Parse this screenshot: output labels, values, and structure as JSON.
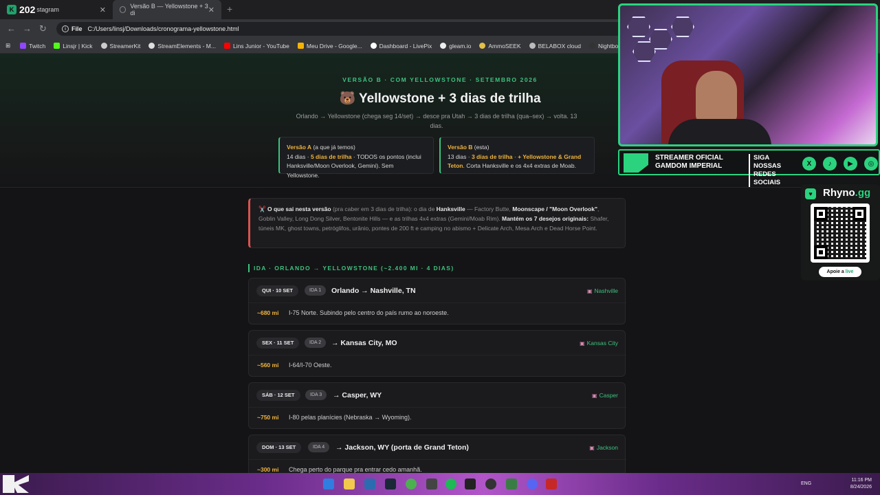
{
  "browser": {
    "tabs": [
      {
        "prefix": "202",
        "label": "stagram"
      },
      {
        "label": "Versão B — Yellowstone + 3 di"
      }
    ],
    "new_tab": "+",
    "url_scheme": "File",
    "url": "C:/Users/linsj/Downloads/cronograma-yellowstone.html",
    "bookmarks": [
      {
        "label": "Twitch",
        "color": "#9146ff"
      },
      {
        "label": "Linsjr | Kick",
        "color": "#53fc18"
      },
      {
        "label": "StreamerKit",
        "color": "#cccccc"
      },
      {
        "label": "StreamElements - M...",
        "color": "#dddddd"
      },
      {
        "label": "Lins Junior - YouTube",
        "color": "#ff0000"
      },
      {
        "label": "Meu Drive - Google...",
        "color": "#f4b400"
      },
      {
        "label": "Dashboard - LivePix",
        "color": "#ffffff"
      },
      {
        "label": "gleam.io",
        "color": "#eeeeee"
      },
      {
        "label": "AmmoSEEK",
        "color": "#e0c04a"
      },
      {
        "label": "BELABOX cloud",
        "color": "#bbbbbb"
      },
      {
        "label": "Nightbot - Comm",
        "color": "#333333"
      }
    ]
  },
  "hero": {
    "kicker": "VERSÃO B · COM YELLOWSTONE · SETEMBRO 2026",
    "title": "🐻 Yellowstone + 3 dias de trilha",
    "subtitle": "Orlando → Yellowstone (chega seg 14/set) → desce pra Utah → 3 dias de trilha (qua–sex) → volta. 13 dias."
  },
  "versions": {
    "a": {
      "name": "Versão A",
      "paren": " (a que já temos)",
      "line_pre": "14 dias · ",
      "highlight": "5 dias de trilha",
      "line_post": " · TODOS os pontos (inclui Hanksville/Moon Overlook, Gemini). Sem Yellowstone."
    },
    "b": {
      "name": "Versão B",
      "paren": " (esta)",
      "line_pre": "13 dias · ",
      "highlight": "3 dias de trilha",
      "mid": " · ",
      "highlight2": "+ Yellowstone & Grand Teton",
      "line_post": ". Corta Hanksville e os 4x4 extras de Moab."
    }
  },
  "notice": {
    "icon": "✂️",
    "b1": "O que sai nesta versão",
    "t1": " (pra caber em 3 dias de trilha): o dia de ",
    "b2": "Hanksville",
    "t2": " — Factory Butte, ",
    "b3": "Moonscape / \"Moon Overlook\"",
    "t3": ", Goblin Valley, Long Dong Silver, Bentonite Hills — e as trilhas 4x4 extras (Gemini/Moab Rim). ",
    "b4": "Mantém os 7 desejos originais:",
    "t4": " Shafer, túneis MK, ghost towns, petróglifos, urânio, pontes de 200 ft e camping no abismo + Delicate Arch, Mesa Arch e Dead Horse Point."
  },
  "section_title": "IDA · ORLANDO → YELLOWSTONE (~2.400 MI · 4 DIAS)",
  "days": [
    {
      "date": "QUI · 10 SET",
      "tag": "IDA 1",
      "route": "Orlando → Nashville, TN",
      "stay": "Nashville",
      "miles": "~680 mi",
      "desc": "I-75 Norte. Subindo pelo centro do país rumo ao noroeste."
    },
    {
      "date": "SEX · 11 SET",
      "tag": "IDA 2",
      "route": "→ Kansas City, MO",
      "stay": "Kansas City",
      "miles": "~560 mi",
      "desc": "I-64/I-70 Oeste."
    },
    {
      "date": "SÁB · 12 SET",
      "tag": "IDA 3",
      "route": "→ Casper, WY",
      "stay": "Casper",
      "miles": "~750 mi",
      "desc": "I-80 pelas planícies (Nebraska → Wyoming)."
    },
    {
      "date": "DOM · 13 SET",
      "tag": "IDA 4",
      "route": "→ Jackson, WY (porta de Grand Teton)",
      "stay": "Jackson",
      "miles": "~300 mi",
      "desc": "Chega perto do parque pra entrar cedo amanhã."
    }
  ],
  "stream": {
    "banner_left": "STREAMER OFICIAL GAMDOM IMPERIAL",
    "banner_right": "SIGA NOSSAS REDES SOCIAIS",
    "socials": [
      "X",
      "♪",
      "▶",
      "◎"
    ],
    "rhyno_name": "Rhyno",
    "rhyno_tld": ".gg",
    "apoie": "Apoie a ",
    "apoie_live": "live"
  },
  "taskbar": {
    "lang": "ENG",
    "time": "11:16 PM",
    "date": "8/24/2026"
  },
  "colors": {
    "accent": "#3ec27e",
    "gold": "#f0b43c",
    "warn": "#d9534f",
    "brand": "#2bd37f"
  }
}
